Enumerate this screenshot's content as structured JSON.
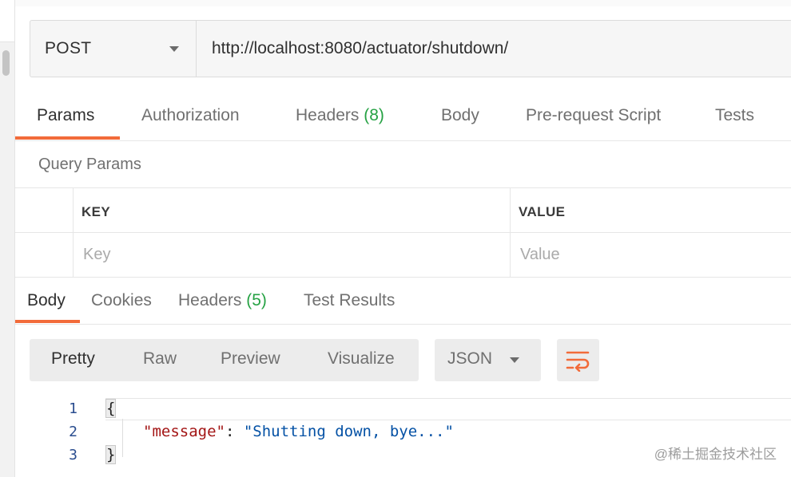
{
  "request": {
    "method": "POST",
    "url": "http://localhost:8080/actuator/shutdown/"
  },
  "request_tabs": [
    {
      "label": "Params",
      "active": true
    },
    {
      "label": "Authorization"
    },
    {
      "label": "Headers",
      "count": "(8)"
    },
    {
      "label": "Body"
    },
    {
      "label": "Pre-request Script"
    },
    {
      "label": "Tests"
    }
  ],
  "query_params": {
    "title": "Query Params",
    "columns": [
      "KEY",
      "VALUE"
    ],
    "placeholders": {
      "key": "Key",
      "value": "Value"
    }
  },
  "response_tabs": [
    {
      "label": "Body",
      "active": true
    },
    {
      "label": "Cookies"
    },
    {
      "label": "Headers",
      "count": "(5)"
    },
    {
      "label": "Test Results"
    }
  ],
  "format_buttons": [
    {
      "label": "Pretty",
      "active": true
    },
    {
      "label": "Raw"
    },
    {
      "label": "Preview"
    },
    {
      "label": "Visualize"
    }
  ],
  "language": "JSON",
  "code": {
    "line_numbers": [
      "1",
      "2",
      "3"
    ],
    "open_brace": "{",
    "close_brace": "}",
    "key": "\"message\"",
    "colon": ": ",
    "value": "\"Shutting down, bye...\""
  },
  "watermark": "@稀土掘金技术社区",
  "colors": {
    "accent": "#f26b3a",
    "count": "#26a244",
    "json_key": "#a31515",
    "json_string": "#0451a5",
    "line_number": "#2a4d8f"
  },
  "icons": {
    "method_caret": "chevron-down-icon",
    "lang_caret": "chevron-down-icon",
    "wrap": "wrap-lines-icon"
  }
}
